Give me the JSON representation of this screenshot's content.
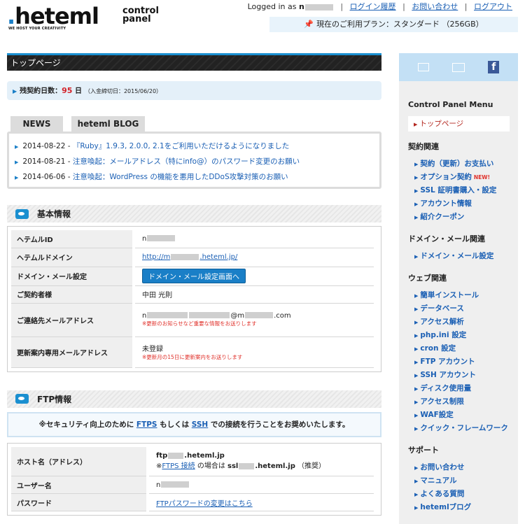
{
  "header": {
    "logo_text": "heteml",
    "logo_tagline": "WE HOST YOUR CREATIVITY",
    "logo_sub_line1": "control",
    "logo_sub_line2": "panel",
    "logged_in_prefix": "Logged in as",
    "logged_in_user": "n",
    "login_history": "ログイン履歴",
    "contact": "お問い合わせ",
    "logout": "ログアウト",
    "separator": "|",
    "plan_text": "現在のご利用プラン：スタンダード （256GB）"
  },
  "page_title": "トップページ",
  "remaining": {
    "label": "残契約日数：",
    "days": "95",
    "unit": "日",
    "note": "（入金締切日：2015/06/20）"
  },
  "news": {
    "tab_news": "NEWS",
    "tab_blog": "heteml BLOG",
    "items": [
      {
        "date": "2014-08-22 -",
        "title": "『Ruby』1.9.3, 2.0.0, 2.1をご利用いただけるようになりました"
      },
      {
        "date": "2014-08-21 -",
        "title": "注意喚起：メールアドレス（特にinfo@）のパスワード変更のお願い"
      },
      {
        "date": "2014-06-06 -",
        "title": "注意喚起：WordPress の機能を悪用したDDoS攻撃対策のお願い"
      }
    ]
  },
  "basic": {
    "title": "基本情報",
    "rows": {
      "id_label": "ヘテムルID",
      "id_value": "n",
      "domain_label": "ヘテムルドメイン",
      "domain_prefix": "http://m",
      "domain_suffix": ".heteml.jp/",
      "dm_label": "ドメイン・メール設定",
      "dm_button": "ドメイン・メール設定画面へ",
      "owner_label": "ご契約者様",
      "owner_value": "中田 光則",
      "email_label": "ご連絡先メールアドレス",
      "email_p1": "n",
      "email_p2": "@m",
      "email_p3": ".com",
      "email_note": "※更新のお知らせなど重要な情報をお送りします",
      "renew_label": "更新案内専用メールアドレス",
      "renew_value": "未登録",
      "renew_note": "※更新月の15日に更新案内をお送りします"
    }
  },
  "ftp": {
    "title": "FTP情報",
    "note_pre": "※セキュリティ向上のために",
    "note_ftps": "FTPS",
    "note_mid": "もしくは",
    "note_ssh": "SSH",
    "note_post": "での接続を行うことをお奨めいたします。",
    "host_label": "ホスト名（アドレス）",
    "host_p1": "ftp",
    "host_p2": ".heteml.jp",
    "host2_pre": "※",
    "host2_link": "FTPS 接続",
    "host2_mid": "の場合は",
    "host2_p1": "ssl",
    "host2_p2": ".heteml.jp",
    "host2_post": "（推奨）",
    "user_label": "ユーザー名",
    "user_value": "n",
    "pass_label": "パスワード",
    "pass_link": "FTPパスワードの変更はこちら"
  },
  "sidebar": {
    "menu_title": "Control Panel Menu",
    "top_item": "トップページ",
    "groups": [
      {
        "title": "契約関連",
        "items": [
          "契約（更新）お支払い",
          "オプション契約",
          "SSL 証明書購入・設定",
          "アカウント情報",
          "紹介クーポン"
        ],
        "new_label": "NEW!"
      },
      {
        "title": "ドメイン・メール関連",
        "items": [
          "ドメイン・メール設定"
        ]
      },
      {
        "title": "ウェブ関連",
        "items": [
          "簡単インストール",
          "データベース",
          "アクセス解析",
          "php.ini 設定",
          "cron 設定",
          "FTP アカウント",
          "SSH アカウント",
          "ディスク使用量",
          "アクセス制限",
          "WAF設定",
          "クイック・フレームワーク"
        ]
      },
      {
        "title": "サポート",
        "items": [
          "お問い合わせ",
          "マニュアル",
          "よくある質問",
          "hetemlブログ"
        ]
      }
    ]
  },
  "colors": {
    "accent": "#1a8fd0",
    "link": "#1a5fb4",
    "alert": "#d2232a"
  }
}
